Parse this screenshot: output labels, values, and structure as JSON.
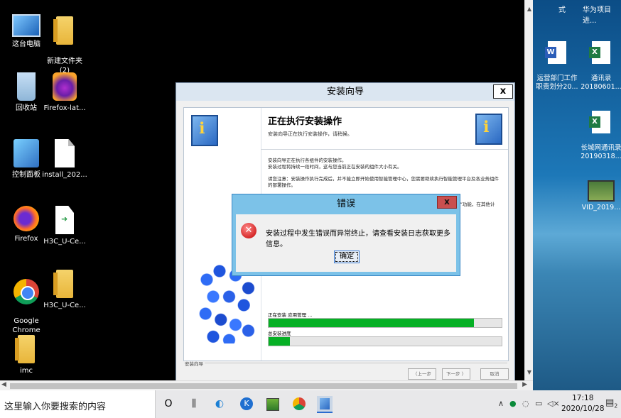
{
  "desktop_icons": [
    {
      "label": "这台电脑",
      "icon": "this-pc-icon"
    },
    {
      "label": "新建文件夹\n(2)",
      "icon": "folder-icon"
    },
    {
      "label": "回收站",
      "icon": "recycle-bin-icon"
    },
    {
      "label": "Firefox-lat...",
      "icon": "firefox-installer-icon"
    },
    {
      "label": "控制面板",
      "icon": "control-panel-icon"
    },
    {
      "label": "install_202...",
      "icon": "file-icon"
    },
    {
      "label": "Firefox",
      "icon": "firefox-icon"
    },
    {
      "label": "H3C_U-Ce...",
      "icon": "executable-icon"
    },
    {
      "label": "Google\nChrome",
      "icon": "chrome-icon"
    },
    {
      "label": "H3C_U-Ce...",
      "icon": "folder-icon"
    },
    {
      "label": "imc",
      "icon": "folder-icon"
    }
  ],
  "wizard": {
    "title": "安装向导",
    "close": "x",
    "heading": "正在执行安装操作",
    "subheading": "安装向导正在执行安装操作，请稍候。",
    "body1": "安装向导正在执行各组件的安装操作。\n安装过程将持续一段时间，这与您当前正在安装的组件大小有关。",
    "body2": "请您注意：安装操作执行完成后，并不能立即开始使用智能管理中心，您需要继续执行智能管理平台及各业务组件的部署操作。",
    "body3_fragment": "署”功能，在其他计",
    "progress_label": "正在安装 应用管理 ...",
    "progress_value": 0.88,
    "overall_label": "总安装进度",
    "overall_value": 0.09,
    "footer": "安装向导",
    "back": "〈上一步",
    "next": "下一步 〉",
    "cancel": "取消"
  },
  "error_dialog": {
    "title": "错误",
    "close": "x",
    "message": "安装过程中发生错误而异常终止，请查看安装日志获取更多信息。",
    "ok": "确定"
  },
  "local_desktop": {
    "top_left": "式",
    "top_right": "华为项目进...",
    "icons": [
      {
        "label": "运营部门工作\n职责划分20...",
        "icon": "word-icon"
      },
      {
        "label": "通讯录\n20180601...",
        "icon": "excel-icon"
      },
      {
        "label": "长城网通讯录\n20190318...",
        "icon": "excel-icon"
      },
      {
        "label": "VID_2019...",
        "icon": "video-icon"
      }
    ]
  },
  "taskbar": {
    "search_placeholder": "这里输入你要搜索的内容",
    "time": "17:18",
    "date": "2020/10/28",
    "notification_count": "2"
  }
}
